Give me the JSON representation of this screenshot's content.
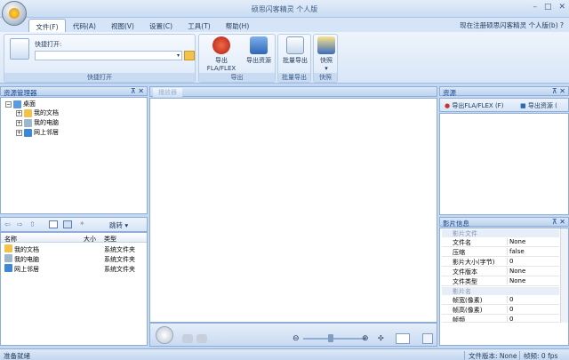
{
  "window": {
    "title": "硕思闪客精灵 个人版",
    "controls": [
      "–",
      "□",
      "✕"
    ]
  },
  "tabs": [
    "文件(F)",
    "代码(A)",
    "视图(V)",
    "设置(C)",
    "工具(T)",
    "帮助(H)"
  ],
  "register_note": "现在注册硕思闪客精灵 个人版(b)",
  "help_mark": "?",
  "ribbon": {
    "quick_open": {
      "label": "快捷打开:",
      "group": "快捷打开"
    },
    "export": {
      "fla": "导出FLA/FLEX",
      "res": "导出资源",
      "group": "导出"
    },
    "batch": {
      "btn": "批量导出",
      "group": "批量导出"
    },
    "snapshot": {
      "btn": "快照",
      "group": "快照"
    }
  },
  "explorer": {
    "title": "资源管理器",
    "tree": [
      {
        "label": "桌面",
        "expander": "−"
      },
      {
        "label": "我的文档",
        "expander": "+"
      },
      {
        "label": "我的电脑",
        "expander": "+"
      },
      {
        "label": "网上邻居",
        "expander": "+"
      }
    ],
    "jump": "跳转",
    "columns": [
      "名称",
      "大小",
      "类型"
    ],
    "rows": [
      {
        "name": "我的文档",
        "size": "",
        "type": "系统文件夹"
      },
      {
        "name": "我的电脑",
        "size": "",
        "type": "系统文件夹"
      },
      {
        "name": "网上邻居",
        "size": "",
        "type": "系统文件夹"
      }
    ]
  },
  "preview": {
    "tab": "播放器"
  },
  "resources": {
    "title": "资源",
    "export_fla": "导出FLA/FLEX (F)",
    "export_res": "导出资源 ("
  },
  "movie_info": {
    "title": "影片信息",
    "sections": [
      {
        "name": "影片文件",
        "rows": [
          {
            "key": "文件名",
            "value": "None"
          },
          {
            "key": "压缩",
            "value": "false"
          },
          {
            "key": "影片大小(字节)",
            "value": "0"
          },
          {
            "key": "文件版本",
            "value": "None"
          },
          {
            "key": "文件类型",
            "value": "None"
          }
        ]
      },
      {
        "name": "影片名",
        "rows": [
          {
            "key": "帧宽(像素)",
            "value": "0"
          },
          {
            "key": "帧高(像素)",
            "value": "0"
          },
          {
            "key": "帧频",
            "value": "0"
          }
        ]
      }
    ]
  },
  "status": {
    "left": "准备就绪",
    "version": "文件版本: None",
    "fps": "帧频: 0 fps"
  },
  "colors": {
    "accent": "#15428b",
    "panel_border": "#8eaed8",
    "ribbon_bg": "#d8e6f7"
  }
}
